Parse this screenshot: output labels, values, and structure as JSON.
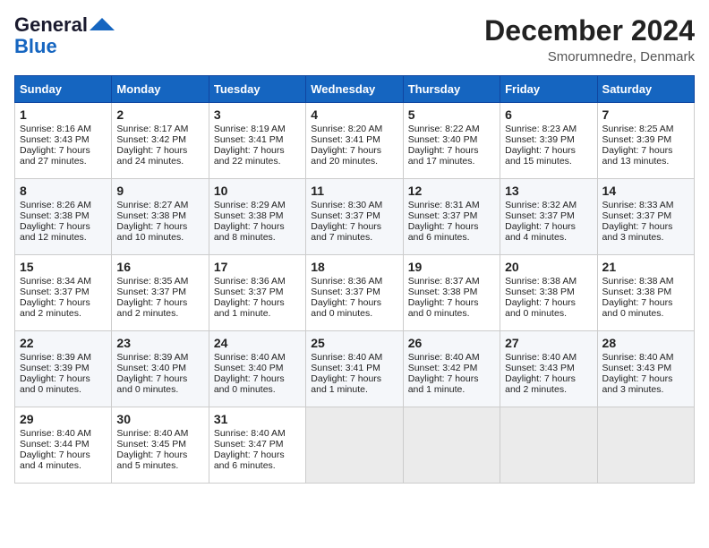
{
  "header": {
    "logo_line1": "General",
    "logo_line2": "Blue",
    "month": "December 2024",
    "location": "Smorumnedre, Denmark"
  },
  "days_of_week": [
    "Sunday",
    "Monday",
    "Tuesday",
    "Wednesday",
    "Thursday",
    "Friday",
    "Saturday"
  ],
  "weeks": [
    [
      {
        "day": 1,
        "sunrise": "8:16 AM",
        "sunset": "3:43 PM",
        "daylight": "7 hours and 27 minutes."
      },
      {
        "day": 2,
        "sunrise": "8:17 AM",
        "sunset": "3:42 PM",
        "daylight": "7 hours and 24 minutes."
      },
      {
        "day": 3,
        "sunrise": "8:19 AM",
        "sunset": "3:41 PM",
        "daylight": "7 hours and 22 minutes."
      },
      {
        "day": 4,
        "sunrise": "8:20 AM",
        "sunset": "3:41 PM",
        "daylight": "7 hours and 20 minutes."
      },
      {
        "day": 5,
        "sunrise": "8:22 AM",
        "sunset": "3:40 PM",
        "daylight": "7 hours and 17 minutes."
      },
      {
        "day": 6,
        "sunrise": "8:23 AM",
        "sunset": "3:39 PM",
        "daylight": "7 hours and 15 minutes."
      },
      {
        "day": 7,
        "sunrise": "8:25 AM",
        "sunset": "3:39 PM",
        "daylight": "7 hours and 13 minutes."
      }
    ],
    [
      {
        "day": 8,
        "sunrise": "8:26 AM",
        "sunset": "3:38 PM",
        "daylight": "7 hours and 12 minutes."
      },
      {
        "day": 9,
        "sunrise": "8:27 AM",
        "sunset": "3:38 PM",
        "daylight": "7 hours and 10 minutes."
      },
      {
        "day": 10,
        "sunrise": "8:29 AM",
        "sunset": "3:38 PM",
        "daylight": "7 hours and 8 minutes."
      },
      {
        "day": 11,
        "sunrise": "8:30 AM",
        "sunset": "3:37 PM",
        "daylight": "7 hours and 7 minutes."
      },
      {
        "day": 12,
        "sunrise": "8:31 AM",
        "sunset": "3:37 PM",
        "daylight": "7 hours and 6 minutes."
      },
      {
        "day": 13,
        "sunrise": "8:32 AM",
        "sunset": "3:37 PM",
        "daylight": "7 hours and 4 minutes."
      },
      {
        "day": 14,
        "sunrise": "8:33 AM",
        "sunset": "3:37 PM",
        "daylight": "7 hours and 3 minutes."
      }
    ],
    [
      {
        "day": 15,
        "sunrise": "8:34 AM",
        "sunset": "3:37 PM",
        "daylight": "7 hours and 2 minutes."
      },
      {
        "day": 16,
        "sunrise": "8:35 AM",
        "sunset": "3:37 PM",
        "daylight": "7 hours and 2 minutes."
      },
      {
        "day": 17,
        "sunrise": "8:36 AM",
        "sunset": "3:37 PM",
        "daylight": "7 hours and 1 minute."
      },
      {
        "day": 18,
        "sunrise": "8:36 AM",
        "sunset": "3:37 PM",
        "daylight": "7 hours and 0 minutes."
      },
      {
        "day": 19,
        "sunrise": "8:37 AM",
        "sunset": "3:38 PM",
        "daylight": "7 hours and 0 minutes."
      },
      {
        "day": 20,
        "sunrise": "8:38 AM",
        "sunset": "3:38 PM",
        "daylight": "7 hours and 0 minutes."
      },
      {
        "day": 21,
        "sunrise": "8:38 AM",
        "sunset": "3:38 PM",
        "daylight": "7 hours and 0 minutes."
      }
    ],
    [
      {
        "day": 22,
        "sunrise": "8:39 AM",
        "sunset": "3:39 PM",
        "daylight": "7 hours and 0 minutes."
      },
      {
        "day": 23,
        "sunrise": "8:39 AM",
        "sunset": "3:40 PM",
        "daylight": "7 hours and 0 minutes."
      },
      {
        "day": 24,
        "sunrise": "8:40 AM",
        "sunset": "3:40 PM",
        "daylight": "7 hours and 0 minutes."
      },
      {
        "day": 25,
        "sunrise": "8:40 AM",
        "sunset": "3:41 PM",
        "daylight": "7 hours and 1 minute."
      },
      {
        "day": 26,
        "sunrise": "8:40 AM",
        "sunset": "3:42 PM",
        "daylight": "7 hours and 1 minute."
      },
      {
        "day": 27,
        "sunrise": "8:40 AM",
        "sunset": "3:43 PM",
        "daylight": "7 hours and 2 minutes."
      },
      {
        "day": 28,
        "sunrise": "8:40 AM",
        "sunset": "3:43 PM",
        "daylight": "7 hours and 3 minutes."
      }
    ],
    [
      {
        "day": 29,
        "sunrise": "8:40 AM",
        "sunset": "3:44 PM",
        "daylight": "7 hours and 4 minutes."
      },
      {
        "day": 30,
        "sunrise": "8:40 AM",
        "sunset": "3:45 PM",
        "daylight": "7 hours and 5 minutes."
      },
      {
        "day": 31,
        "sunrise": "8:40 AM",
        "sunset": "3:47 PM",
        "daylight": "7 hours and 6 minutes."
      },
      null,
      null,
      null,
      null
    ]
  ]
}
